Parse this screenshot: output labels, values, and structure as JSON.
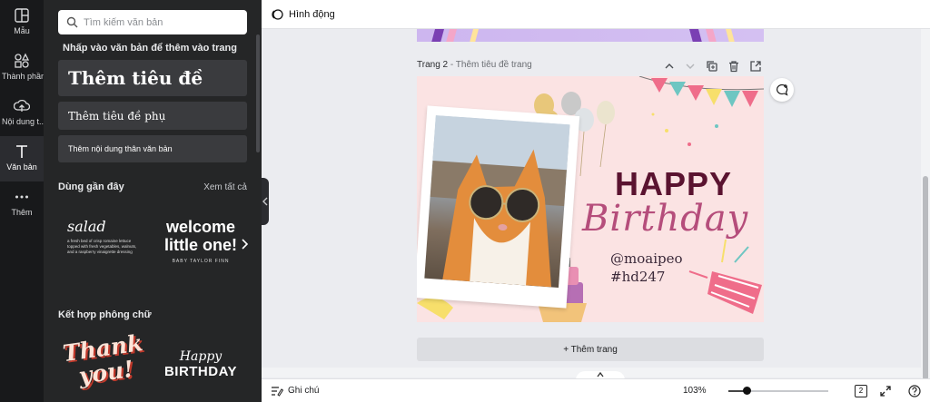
{
  "rail": {
    "items": [
      {
        "label": "Mẫu",
        "icon": "template-icon"
      },
      {
        "label": "Thành phần",
        "icon": "elements-icon"
      },
      {
        "label": "Nội dung t...",
        "icon": "upload-cloud-icon"
      },
      {
        "label": "Văn bản",
        "icon": "text-icon"
      },
      {
        "label": "Thêm",
        "icon": "more-dots-icon"
      }
    ],
    "active_index": 3
  },
  "panel": {
    "search_placeholder": "Tìm kiếm văn bản",
    "hint": "Nhấp vào văn bản để thêm vào trang",
    "heading_button": "Thêm tiêu đề",
    "subheading_button": "Thêm tiêu đề phụ",
    "body_button": "Thêm nội dung thân văn bản",
    "recent_title": "Dùng gần đây",
    "see_all": "Xem tất cả",
    "recent_cards": [
      {
        "title": "salad",
        "body": "a fresh bed of crisp romaine lettuce topped with fresh vegetables, walnuts, and a raspberry vinaigrette dressing"
      },
      {
        "title": "welcome little one!",
        "body": "BABY TAYLOR FINN"
      }
    ],
    "combo_title": "Kết hợp phông chữ",
    "combo_cards": [
      {
        "title": "Thank you!"
      },
      {
        "title": "Happy",
        "body": "BIRTHDAY"
      }
    ]
  },
  "topbar": {
    "animate_label": "Hình động"
  },
  "canvas": {
    "page_label": "Trang 2",
    "page_sub": "- Thêm tiêu đề trang",
    "happy": "HAPPY",
    "birthday": "Birthday",
    "handle1": "@moaipeo",
    "handle2": "#hd247",
    "add_page": "+ Thêm trang"
  },
  "bottombar": {
    "notes_label": "Ghi chú",
    "zoom": "103%",
    "page_count": "2"
  },
  "colors": {
    "rail_bg": "#18191b",
    "panel_bg": "#252627",
    "page_bg": "#fbe3e3",
    "happy": "#5a1330",
    "birthday": "#b54d7b"
  }
}
